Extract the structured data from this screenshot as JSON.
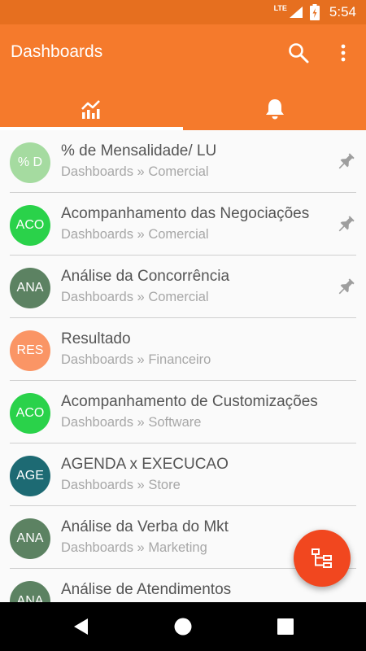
{
  "status_bar": {
    "network": "LTE",
    "time": "5:54"
  },
  "app_bar": {
    "title": "Dashboards"
  },
  "tabs": [
    {
      "icon": "chart-icon",
      "selected": true
    },
    {
      "icon": "bell-icon",
      "selected": false
    }
  ],
  "colors": {
    "accent": "#f57a2c",
    "status": "#e66f1f",
    "fab": "#f1471f"
  },
  "dashboards": [
    {
      "avatar": "% D",
      "avatar_color": "#a5dba0",
      "name": "% de Mensalidade/ LU",
      "path": "Dashboards » Comercial",
      "pinned": true
    },
    {
      "avatar": "ACO",
      "avatar_color": "#2ad24a",
      "name": "Acompanhamento das Negociações",
      "path": "Dashboards » Comercial",
      "pinned": true
    },
    {
      "avatar": "ANA",
      "avatar_color": "#5c8262",
      "name": "Análise da Concorrência",
      "path": "Dashboards » Comercial",
      "pinned": true
    },
    {
      "avatar": "RES",
      "avatar_color": "#fa9565",
      "name": "Resultado",
      "path": "Dashboards » Financeiro",
      "pinned": false
    },
    {
      "avatar": "ACO",
      "avatar_color": "#2ad24a",
      "name": "Acompanhamento de Customizações",
      "path": "Dashboards » Software",
      "pinned": false
    },
    {
      "avatar": "AGE",
      "avatar_color": "#1d6a73",
      "name": "AGENDA x EXECUCAO",
      "path": "Dashboards » Store",
      "pinned": false
    },
    {
      "avatar": "ANA",
      "avatar_color": "#5c8262",
      "name": "Análise da Verba do Mkt",
      "path": "Dashboards » Marketing",
      "pinned": false
    },
    {
      "avatar": "ANA",
      "avatar_color": "#5c8262",
      "name": "Análise de Atendimentos",
      "path": "",
      "pinned": false
    }
  ],
  "fab": {
    "icon": "hierarchy-icon"
  },
  "nav": {
    "buttons": [
      "back-icon",
      "home-icon",
      "recents-icon"
    ]
  }
}
